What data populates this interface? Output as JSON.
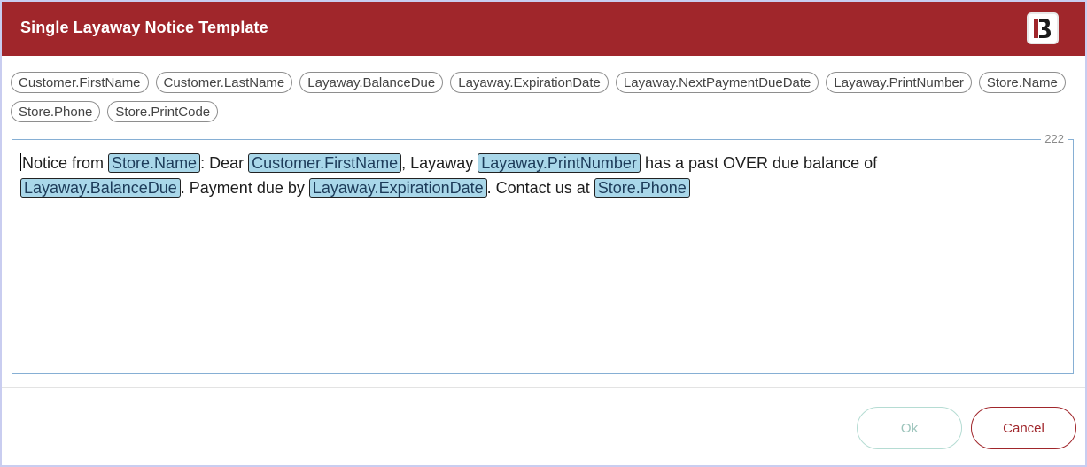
{
  "dialog": {
    "title": "Single Layaway Notice Template",
    "brand_color": "#a0262b",
    "logo_icon": "b-logo-icon"
  },
  "chips": {
    "row1": [
      "Customer.FirstName",
      "Customer.LastName",
      "Layaway.BalanceDue",
      "Layaway.ExpirationDate",
      "Layaway.NextPaymentDueDate",
      "Layaway.PrintNumber",
      "Store.Name"
    ],
    "row2": [
      "Store.Phone",
      "Store.PrintCode"
    ]
  },
  "editor": {
    "char_count": "222",
    "segments": [
      "Notice from ",
      "Store.Name",
      ": Dear ",
      "Customer.FirstName",
      ", Layaway ",
      "Layaway.PrintNumber",
      " has a past OVER due balance of ",
      "Layaway.BalanceDue",
      ". Payment due by ",
      "Layaway.ExpirationDate",
      ". Contact us at ",
      "Store.Phone"
    ]
  },
  "buttons": {
    "ok": "Ok",
    "cancel": "Cancel"
  }
}
